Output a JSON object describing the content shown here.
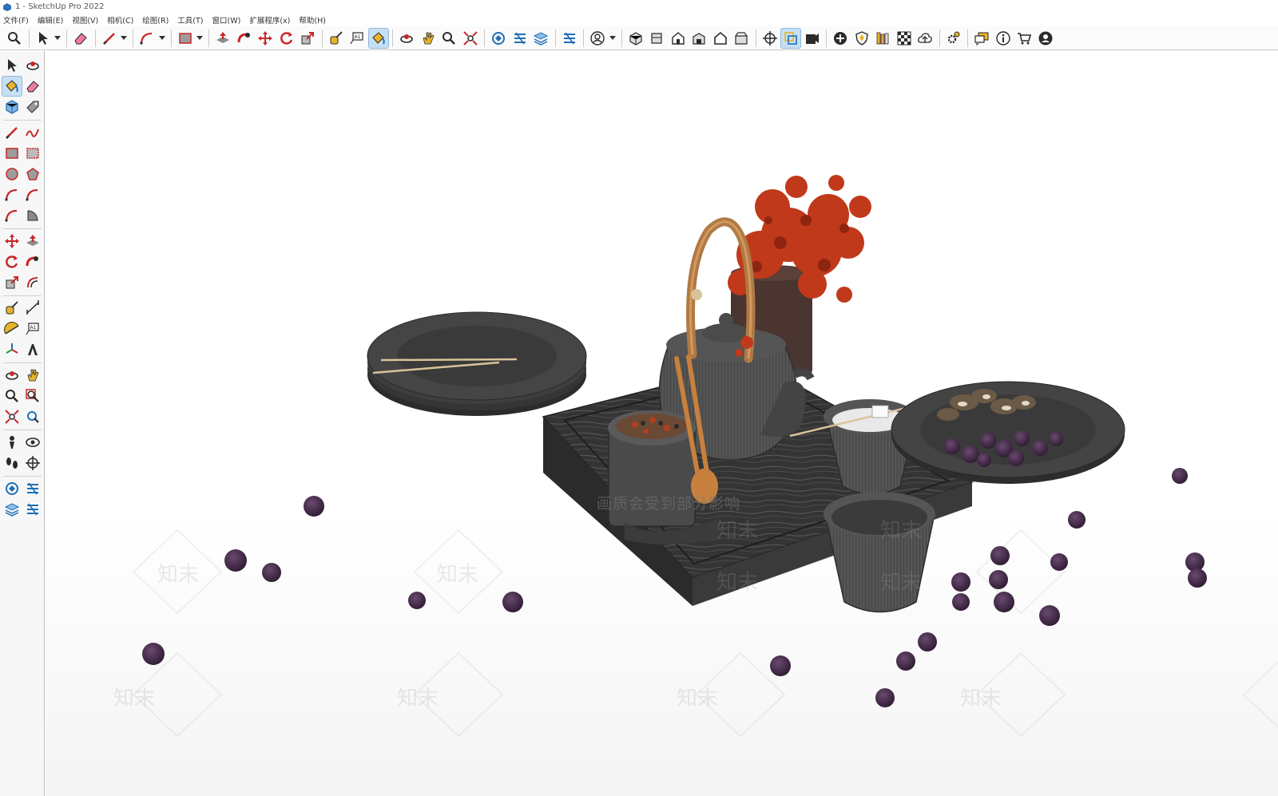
{
  "window": {
    "title": "1 - SketchUp Pro 2022",
    "app_icon": "sketchup-icon"
  },
  "menubar": {
    "items": [
      "文件(F)",
      "编辑(E)",
      "视图(V)",
      "相机(C)",
      "绘图(R)",
      "工具(T)",
      "窗口(W)",
      "扩展程序(x)",
      "帮助(H)"
    ]
  },
  "toolbar": {
    "groups": [
      [
        "zoom-icon"
      ],
      [
        "select-arrow-icon",
        "dropdown"
      ],
      [
        "eraser-icon"
      ],
      [
        "pencil-line-icon",
        "dropdown"
      ],
      [
        "arc-icon",
        "dropdown"
      ],
      [
        "rectangle-icon",
        "dropdown"
      ],
      [
        "push-pull-icon",
        "follow-me-icon",
        "move-icon",
        "rotate-icon",
        "scale-icon"
      ],
      [
        "tape-measure-icon",
        "text-label-icon",
        "paint-bucket-icon"
      ],
      [
        "orbit-icon",
        "pan-icon",
        "zoom-magnifier-icon",
        "zoom-extents-icon"
      ],
      [
        "warehouse-icon",
        "extension-warehouse-icon",
        "layer-icon"
      ],
      [
        "extension-manager-icon"
      ],
      [
        "user-account-icon",
        "dropdown"
      ],
      [
        "iso-view-icon",
        "top-view-icon",
        "front-view-icon",
        "right-view-icon",
        "back-view-icon",
        "left-view-icon"
      ],
      [
        "section-plane-icon",
        "section-display-icon",
        "section-cut-icon"
      ],
      [
        "add-location-icon",
        "shield-icon",
        "library-icon",
        "checker-icon",
        "cloud-upload-icon"
      ],
      [
        "settings-gear-icon"
      ],
      [
        "chat-bubble-icon",
        "info-icon",
        "shop-cart-icon",
        "profile-icon"
      ]
    ],
    "active": [
      "paint-bucket-icon",
      "section-display-icon"
    ]
  },
  "left_toolbar": {
    "rows": [
      [
        "select-arrow-icon",
        "orbit-small-icon"
      ],
      [
        "paint-bucket-icon",
        "eraser-icon"
      ],
      [
        "component-icon",
        "tag-icon"
      ],
      [
        "line-icon",
        "freehand-icon"
      ],
      [
        "rectangle-icon",
        "rotated-rectangle-icon"
      ],
      [
        "circle-icon",
        "polygon-icon"
      ],
      [
        "arc-icon",
        "two-point-arc-icon"
      ],
      [
        "three-point-arc-icon",
        "pie-icon"
      ],
      [
        "move-icon",
        "push-pull-icon"
      ],
      [
        "rotate-icon",
        "follow-me-icon"
      ],
      [
        "scale-icon",
        "offset-icon"
      ],
      [
        "tape-measure-icon",
        "dimension-icon"
      ],
      [
        "protractor-icon",
        "text-icon"
      ],
      [
        "axes-icon",
        "three-d-text-icon"
      ],
      [
        "orbit-icon",
        "pan-icon"
      ],
      [
        "zoom-icon",
        "zoom-window-icon"
      ],
      [
        "zoom-extents-icon",
        "previous-view-icon"
      ],
      [
        "position-camera-icon",
        "look-around-icon"
      ],
      [
        "walk-icon",
        "section-plane-icon"
      ],
      [
        "warehouse-icon",
        "extension-warehouse-icon"
      ],
      [
        "layers-icon",
        "extension-manager-icon"
      ]
    ],
    "active": [
      "paint-bucket-icon"
    ]
  },
  "viewport": {
    "model_name": "tea-set-scene",
    "watermark_text": "画质会受到部分影响",
    "watermark_logo": "知末",
    "colors": {
      "background": "#ffffff",
      "floor": "#f6f6f6",
      "tray_wood": "#3b3b3b",
      "ceramic": "#4a4a4a",
      "handle_wood": "#b07a45",
      "flowers": "#c0391a",
      "berries": "#3d2540"
    }
  }
}
